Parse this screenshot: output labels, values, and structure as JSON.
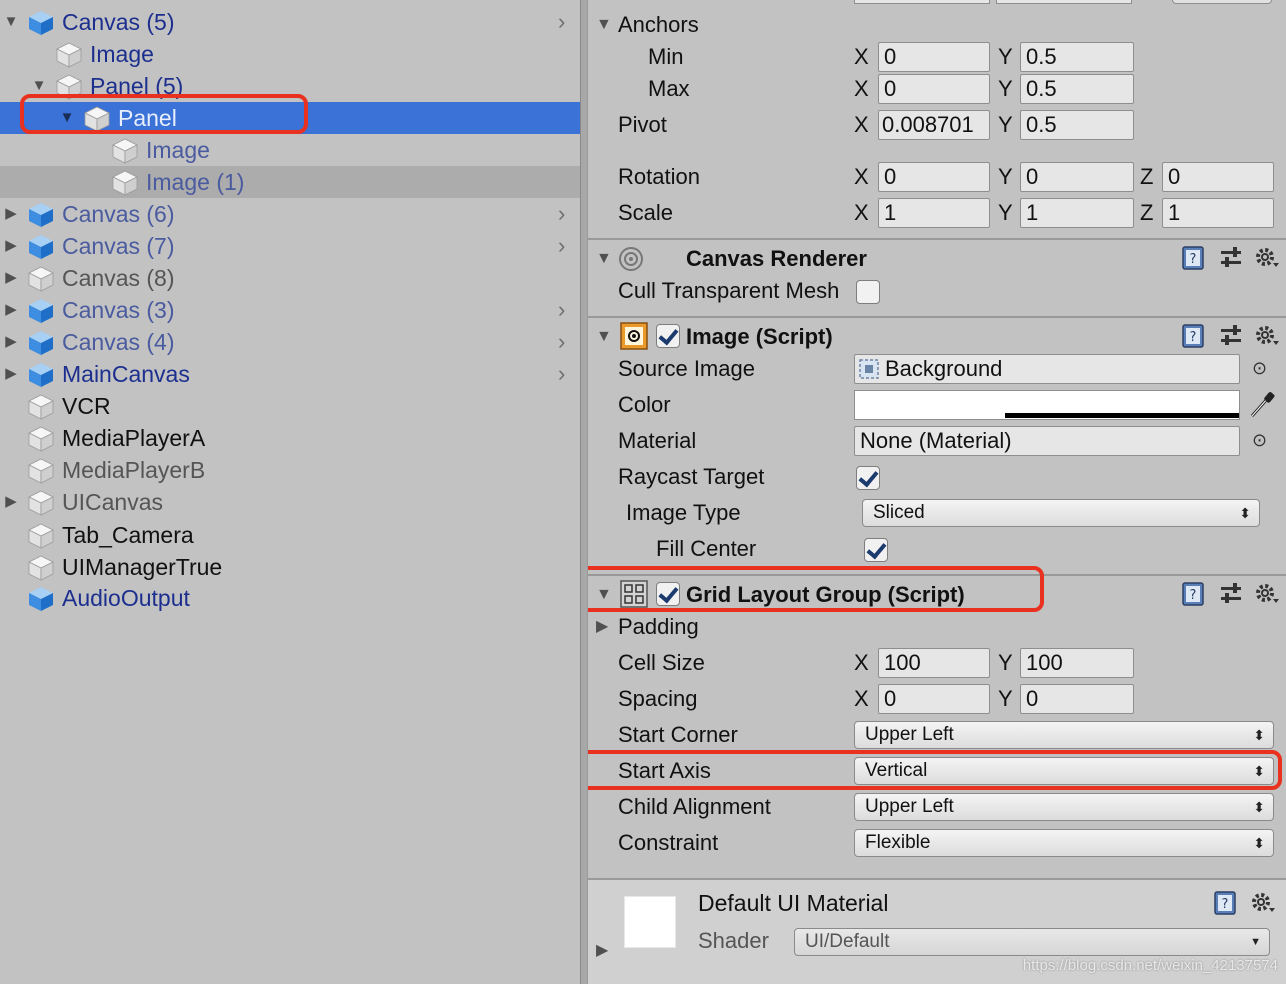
{
  "hierarchy": {
    "items": [
      {
        "label": "Canvas (5)"
      },
      {
        "label": "Image"
      },
      {
        "label": "Panel (5)"
      },
      {
        "label": "Panel"
      },
      {
        "label": "Image"
      },
      {
        "label": "Image (1)"
      },
      {
        "label": "Canvas (6)"
      },
      {
        "label": "Canvas (7)"
      },
      {
        "label": "Canvas (8)"
      },
      {
        "label": "Canvas (3)"
      },
      {
        "label": "Canvas (4)"
      },
      {
        "label": "MainCanvas"
      },
      {
        "label": "VCR"
      },
      {
        "label": "MediaPlayerA"
      },
      {
        "label": "MediaPlayerB"
      },
      {
        "label": "UICanvas"
      },
      {
        "label": "Tab_Camera"
      },
      {
        "label": "UIManagerTrue"
      },
      {
        "label": "AudioOutput"
      }
    ]
  },
  "inspector": {
    "rect_transform": {
      "anchors_label": "Anchors",
      "min_label": "Min",
      "max_label": "Max",
      "pivot_label": "Pivot",
      "rotation_label": "Rotation",
      "scale_label": "Scale",
      "axis_x": "X",
      "axis_y": "Y",
      "axis_z": "Z",
      "min_x": "0",
      "min_y": "0.5",
      "max_x": "0",
      "max_y": "0.5",
      "pivot_x": "0.008701",
      "pivot_y": "0.5",
      "rotation_x": "0",
      "rotation_y": "0",
      "rotation_z": "0",
      "scale_x": "1",
      "scale_y": "1",
      "scale_z": "1"
    },
    "canvas_renderer": {
      "title": "Canvas Renderer",
      "cull_label": "Cull Transparent Mesh",
      "cull_checked": false
    },
    "image": {
      "title": "Image (Script)",
      "source_image_label": "Source Image",
      "source_image_value": "Background",
      "color_label": "Color",
      "color_value": "#ffffff",
      "material_label": "Material",
      "material_value": "None (Material)",
      "raycast_label": "Raycast Target",
      "raycast_checked": true,
      "image_type_label": "Image Type",
      "image_type_value": "Sliced",
      "fill_center_label": "Fill Center",
      "fill_center_checked": true
    },
    "grid_layout": {
      "title": "Grid Layout Group (Script)",
      "padding_label": "Padding",
      "cell_size_label": "Cell Size",
      "cell_size_x": "100",
      "cell_size_y": "100",
      "spacing_label": "Spacing",
      "spacing_x": "0",
      "spacing_y": "0",
      "start_corner_label": "Start Corner",
      "start_corner_value": "Upper Left",
      "start_axis_label": "Start Axis",
      "start_axis_value": "Vertical",
      "child_alignment_label": "Child Alignment",
      "child_alignment_value": "Upper Left",
      "constraint_label": "Constraint",
      "constraint_value": "Flexible"
    },
    "material": {
      "title": "Default UI Material",
      "shader_label": "Shader",
      "shader_value": "UI/Default"
    }
  },
  "watermark": "https://blog.csdn.net/weixin_42137574",
  "colors": {
    "selection": "#3a72d8",
    "highlight_box": "#e8321f",
    "panel_bg": "#c2c2c2",
    "prefab_text": "#1c2f8f"
  },
  "icons": [
    "cube-icon",
    "prefab-cube-icon",
    "help-book-icon",
    "preset-sliders-icon",
    "gear-icon",
    "canvas-renderer-icon",
    "image-component-icon",
    "grid-layout-icon",
    "object-picker-icon",
    "eyedropper-icon"
  ]
}
